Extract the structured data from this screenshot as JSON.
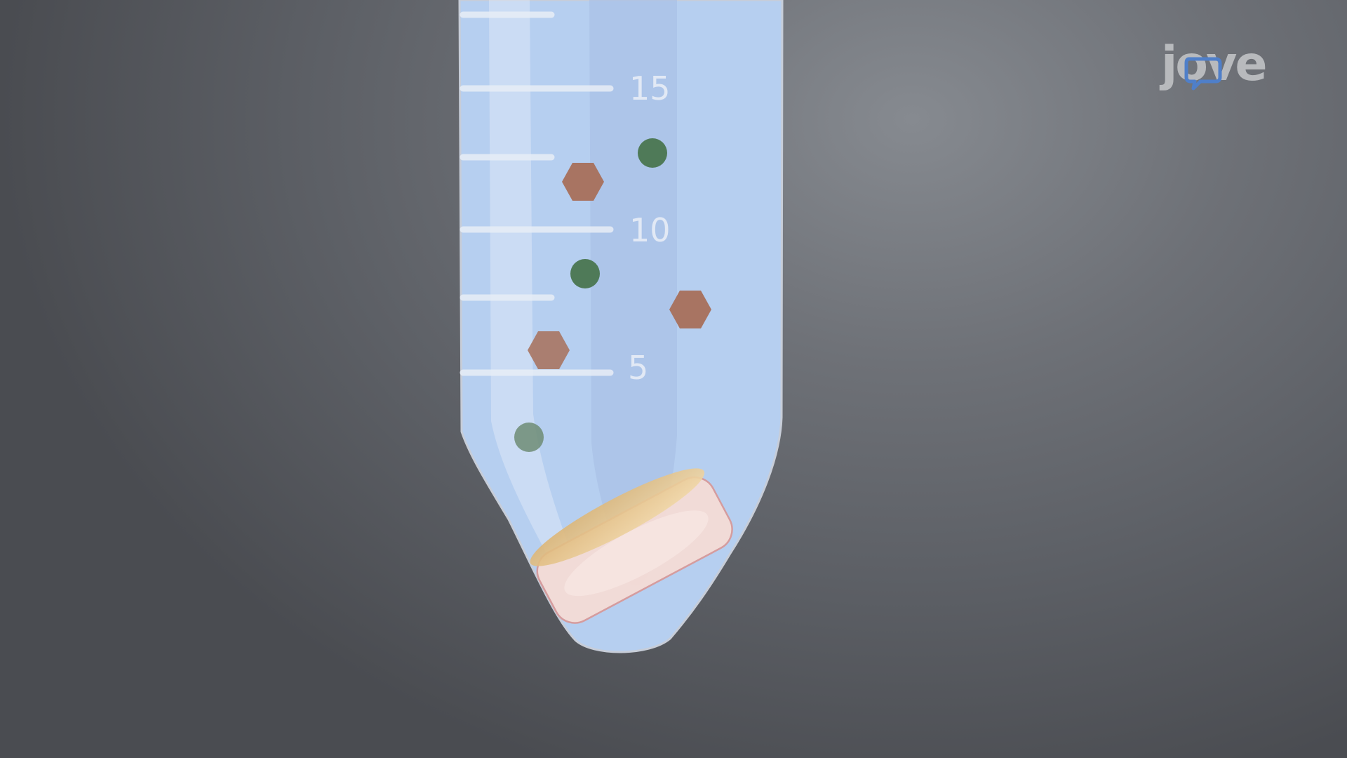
{
  "brand": {
    "logo_text": "jove",
    "logo_icon": "speech-bubble-icon",
    "logo_color": "#b8babd",
    "logo_accent_color": "#4f7fc9"
  },
  "tube": {
    "fill_color": "#b6cff0",
    "graduation_labels": [
      "15",
      "10",
      "5"
    ]
  },
  "particles": {
    "green_spheres": 3,
    "brown_hexagons": 3,
    "green_color": "#4f7a58",
    "brown_color": "#a87462"
  },
  "pellet": {
    "color": "#f5dcd6",
    "top_color": "#e7c48c"
  }
}
